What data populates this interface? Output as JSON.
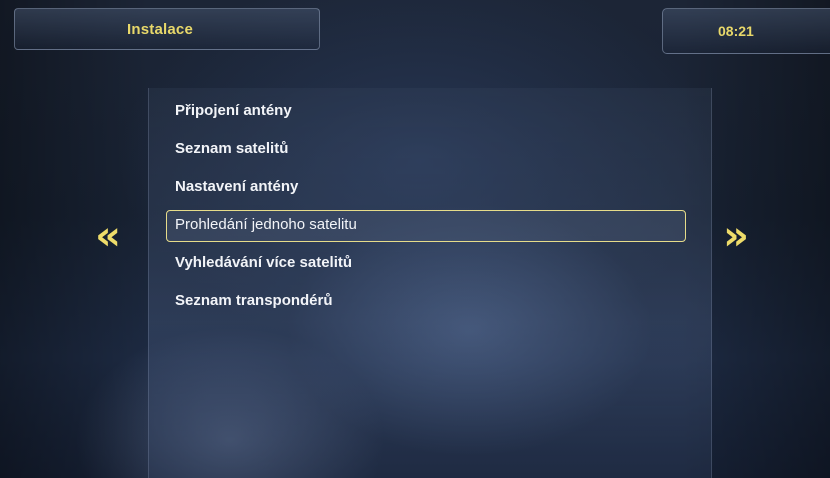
{
  "header": {
    "title": "Instalace",
    "time": "08:21"
  },
  "menu": {
    "items": [
      {
        "label": "Připojení antény",
        "selected": false
      },
      {
        "label": "Seznam satelitů",
        "selected": false
      },
      {
        "label": "Nastavení antény",
        "selected": false
      },
      {
        "label": "Prohledání jednoho satelitu",
        "selected": true
      },
      {
        "label": "Vyhledávání více satelitů",
        "selected": false
      },
      {
        "label": "Seznam transpondérů",
        "selected": false
      }
    ]
  },
  "navigation": {
    "prev_symbol": "«",
    "next_symbol": "»"
  },
  "colors": {
    "accent": "#e8d86a",
    "text": "#f2f4f8",
    "selection_border": "#e6dc8a"
  }
}
